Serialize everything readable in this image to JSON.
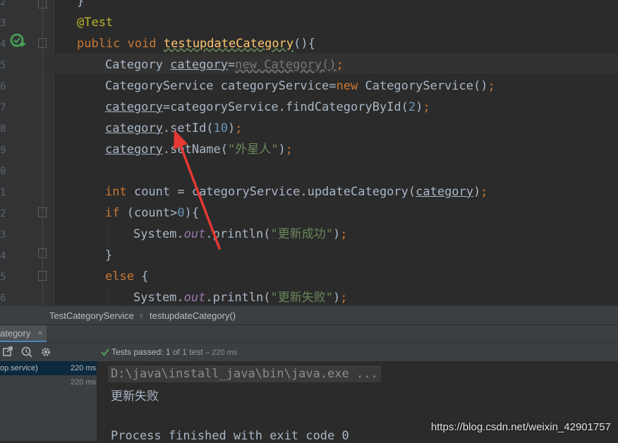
{
  "editor": {
    "line_numbers": [
      "2",
      "3",
      "4",
      "5",
      "6",
      "7",
      "8",
      "9",
      "0",
      "1",
      "2",
      "3",
      "4",
      "5",
      "6"
    ],
    "annotation": "@Test",
    "method_kw_public": "public",
    "method_kw_void": "void",
    "method_name": "testupdateCategory",
    "method_paren": "(){",
    "l5_type": "Category ",
    "l5_var": "category",
    "l5_eq": "=",
    "l5_new": "new Category()",
    "l5_semi": ";",
    "l6_decl": "CategoryService categoryService=",
    "l6_new": "new",
    "l6_ctor": " CategoryService()",
    "l6_semi": ";",
    "l7_var": "category",
    "l7_rest": "=categoryService.findCategoryById(",
    "l7_num": "2",
    "l7_close": ")",
    "l7_semi": ";",
    "l8_var": "category",
    "l8_method": ".setId(",
    "l8_num": "10",
    "l8_close": ")",
    "l8_semi": ";",
    "l9_var": "category",
    "l9_method": ".setName(",
    "l9_str": "\"外星人\"",
    "l9_close": ")",
    "l9_semi": ";",
    "l11_int": "int",
    "l11_rest": " count = categoryService.updateCategory(",
    "l11_arg": "category",
    "l11_close": ")",
    "l11_semi": ";",
    "l12_if": "if",
    "l12_cond": " (count>",
    "l12_num": "0",
    "l12_close": "){",
    "l13_sys": "System.",
    "l13_out": "out",
    "l13_println": ".println(",
    "l13_str": "\"更新成功\"",
    "l13_close": ")",
    "l13_semi": ";",
    "l14_brace": "}",
    "l15_else": "else",
    "l15_brace": " {",
    "l16_sys": "System.",
    "l16_out": "out",
    "l16_println": ".println(",
    "l16_str": "\"更新失败\"",
    "l16_close": ")",
    "l16_semi": ";",
    "top_fragment": "}"
  },
  "breadcrumb": {
    "items": [
      "TestCategoryService",
      "testupdateCategory()"
    ],
    "separator": "›"
  },
  "run_tab": {
    "label": "ategory",
    "close": "×"
  },
  "test_status": {
    "passed_text": "Tests passed:",
    "count_text": "1",
    "of_text": "of 1 test",
    "time_text": "– 220 ms"
  },
  "test_tree": [
    {
      "label": "op.service)",
      "time": "220 ms"
    },
    {
      "label": "",
      "time": "220 ms"
    }
  ],
  "console": {
    "lines": [
      "D:\\java\\install_java\\bin\\java.exe ...",
      "更新失败",
      "",
      "Process finished with exit code 0"
    ]
  },
  "watermark": "https://blog.csdn.net/weixin_42901757",
  "colors": {
    "accent_arrow": "#e53935",
    "pass_green": "#499c54"
  }
}
